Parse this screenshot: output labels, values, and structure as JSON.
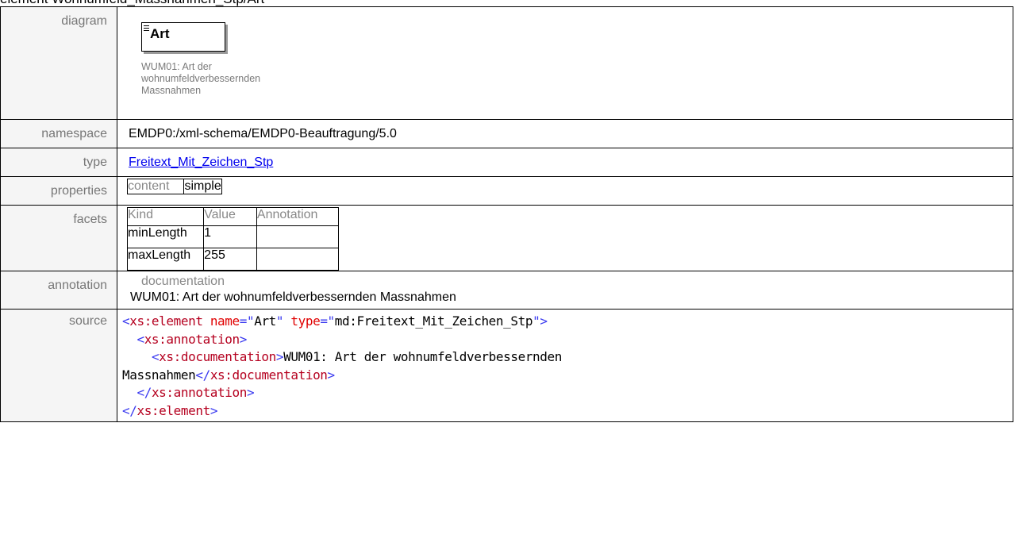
{
  "page": {
    "heading": "element Wohnumfeld_Massnahmen_Stp/Art"
  },
  "labels": {
    "diagram": "diagram",
    "namespace": "namespace",
    "type": "type",
    "properties": "properties",
    "facets": "facets",
    "annotation": "annotation",
    "source": "source"
  },
  "diagram": {
    "element_name": "Art",
    "caption": "WUM01: Art der wohnumfeldverbessernden Massnahmen"
  },
  "namespace": {
    "value": "EMDP0:/xml-schema/EMDP0-Beauftragung/5.0"
  },
  "type": {
    "link_text": "Freitext_Mit_Zeichen_Stp"
  },
  "properties": {
    "key": "content",
    "value": "simple"
  },
  "facets": {
    "headers": [
      "Kind",
      "Value",
      "Annotation"
    ],
    "rows": [
      {
        "kind": "minLength",
        "value": "1"
      },
      {
        "kind": "maxLength",
        "value": "255"
      }
    ]
  },
  "annotation": {
    "heading": "documentation",
    "text": "WUM01: Art der wohnumfeldverbessernden Massnahmen"
  },
  "source": {
    "t1": "<",
    "e1": "xs:element",
    "a1": "name",
    "eq1": "=\"",
    "v1": "Art",
    "q1": "\"",
    "a2": "type",
    "eq2": "=\"",
    "v2": "md:Freitext_Mit_Zeichen_Stp",
    "q2": "\"",
    "t2": ">",
    "t3": "<",
    "e2": "xs:annotation",
    "t4": ">",
    "t5": "<",
    "e3": "xs:documentation",
    "t6": ">",
    "doc_line1": "WUM01: Art der wohnumfeldverbessernden",
    "doc_line2": "Massnahmen",
    "t7": "</",
    "e4": "xs:documentation",
    "t8": ">",
    "t9": "</",
    "e5": "xs:annotation",
    "t10": ">",
    "t11": "</",
    "e6": "xs:element",
    "t12": ">"
  },
  "colors": {
    "label_bg": "#f5f5f5",
    "label_text": "#777777",
    "link": "#0000ee",
    "xml_bracket": "#3a3af0",
    "xml_element": "#b5001f",
    "xml_attribute": "#e00000"
  }
}
